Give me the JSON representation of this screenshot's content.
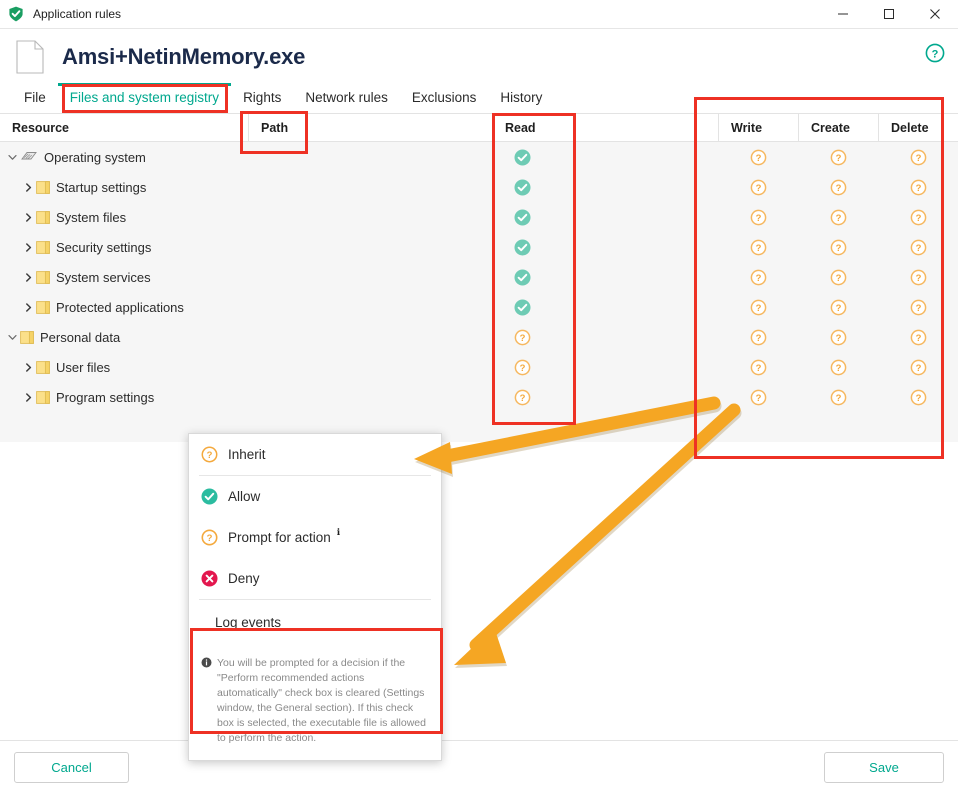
{
  "window": {
    "title": "Application rules",
    "shield_icon": "shield-check-icon",
    "minimize_label": "—",
    "maximize_label": "□",
    "close_label": "✕"
  },
  "header": {
    "app_file_name": "Amsi+NetinMemory.exe",
    "file_icon": "document-icon",
    "help_icon": "help-circle-icon"
  },
  "tabs": [
    {
      "label": "File",
      "active": false
    },
    {
      "label": "Files and system registry",
      "active": true
    },
    {
      "label": "Rights",
      "active": false
    },
    {
      "label": "Network rules",
      "active": false
    },
    {
      "label": "Exclusions",
      "active": false
    },
    {
      "label": "History",
      "active": false
    }
  ],
  "table": {
    "columns": [
      "Resource",
      "Path",
      "Read",
      "Write",
      "Create",
      "Delete"
    ],
    "rows": [
      {
        "label": "Operating system",
        "level": 0,
        "twisty": "expanded",
        "icon": "chip-icon",
        "path": "",
        "read": "allow",
        "write": "inherit",
        "create": "inherit",
        "delete": "inherit"
      },
      {
        "label": "Startup settings",
        "level": 1,
        "twisty": "collapsed",
        "icon": "folder-icon",
        "path": "",
        "read": "allow",
        "write": "inherit",
        "create": "inherit",
        "delete": "inherit"
      },
      {
        "label": "System files",
        "level": 1,
        "twisty": "collapsed",
        "icon": "folder-icon",
        "path": "",
        "read": "allow",
        "write": "inherit",
        "create": "inherit",
        "delete": "inherit"
      },
      {
        "label": "Security settings",
        "level": 1,
        "twisty": "collapsed",
        "icon": "folder-icon",
        "path": "",
        "read": "allow",
        "write": "inherit",
        "create": "inherit",
        "delete": "inherit"
      },
      {
        "label": "System services",
        "level": 1,
        "twisty": "collapsed",
        "icon": "folder-icon",
        "path": "",
        "read": "allow",
        "write": "inherit",
        "create": "inherit",
        "delete": "inherit"
      },
      {
        "label": "Protected applications",
        "level": 1,
        "twisty": "collapsed",
        "icon": "folder-icon",
        "path": "",
        "read": "allow",
        "write": "inherit",
        "create": "inherit",
        "delete": "inherit"
      },
      {
        "label": "Personal data",
        "level": 0,
        "twisty": "expanded",
        "icon": "folder-icon",
        "path": "",
        "read": "inherit",
        "write": "inherit",
        "create": "inherit",
        "delete": "inherit"
      },
      {
        "label": "User files",
        "level": 1,
        "twisty": "collapsed",
        "icon": "folder-icon",
        "path": "",
        "read": "inherit",
        "write": "inherit",
        "create": "inherit",
        "delete": "inherit"
      },
      {
        "label": "Program settings",
        "level": 1,
        "twisty": "collapsed",
        "icon": "folder-icon",
        "path": "",
        "read": "inherit",
        "write": "inherit",
        "create": "inherit",
        "delete": "inherit"
      }
    ]
  },
  "context_menu": {
    "items": [
      {
        "label": "Inherit",
        "icon": "inherit-question-icon"
      },
      {
        "label": "Allow",
        "icon": "allow-check-icon"
      },
      {
        "label": "Prompt for action",
        "icon": "prompt-question-icon",
        "info_badge": "ℹ"
      },
      {
        "label": "Deny",
        "icon": "deny-cross-icon"
      },
      {
        "label": "Log events",
        "icon": ""
      }
    ],
    "note_icon": "info-icon",
    "note_text": "You will be prompted for a decision if the \"Perform recommended actions automatically\" check box is cleared (Settings window, the General section). If this check box is selected, the executable file is allowed to perform the action."
  },
  "footer": {
    "cancel_label": "Cancel",
    "save_label": "Save"
  },
  "colors": {
    "accent_teal": "#00a88e",
    "allow_green": "#4ec7ae",
    "inherit_orange": "#f4a93d",
    "deny_red": "#e3174e",
    "annotation_red": "#ee3124",
    "arrow_orange": "#f5a623"
  }
}
